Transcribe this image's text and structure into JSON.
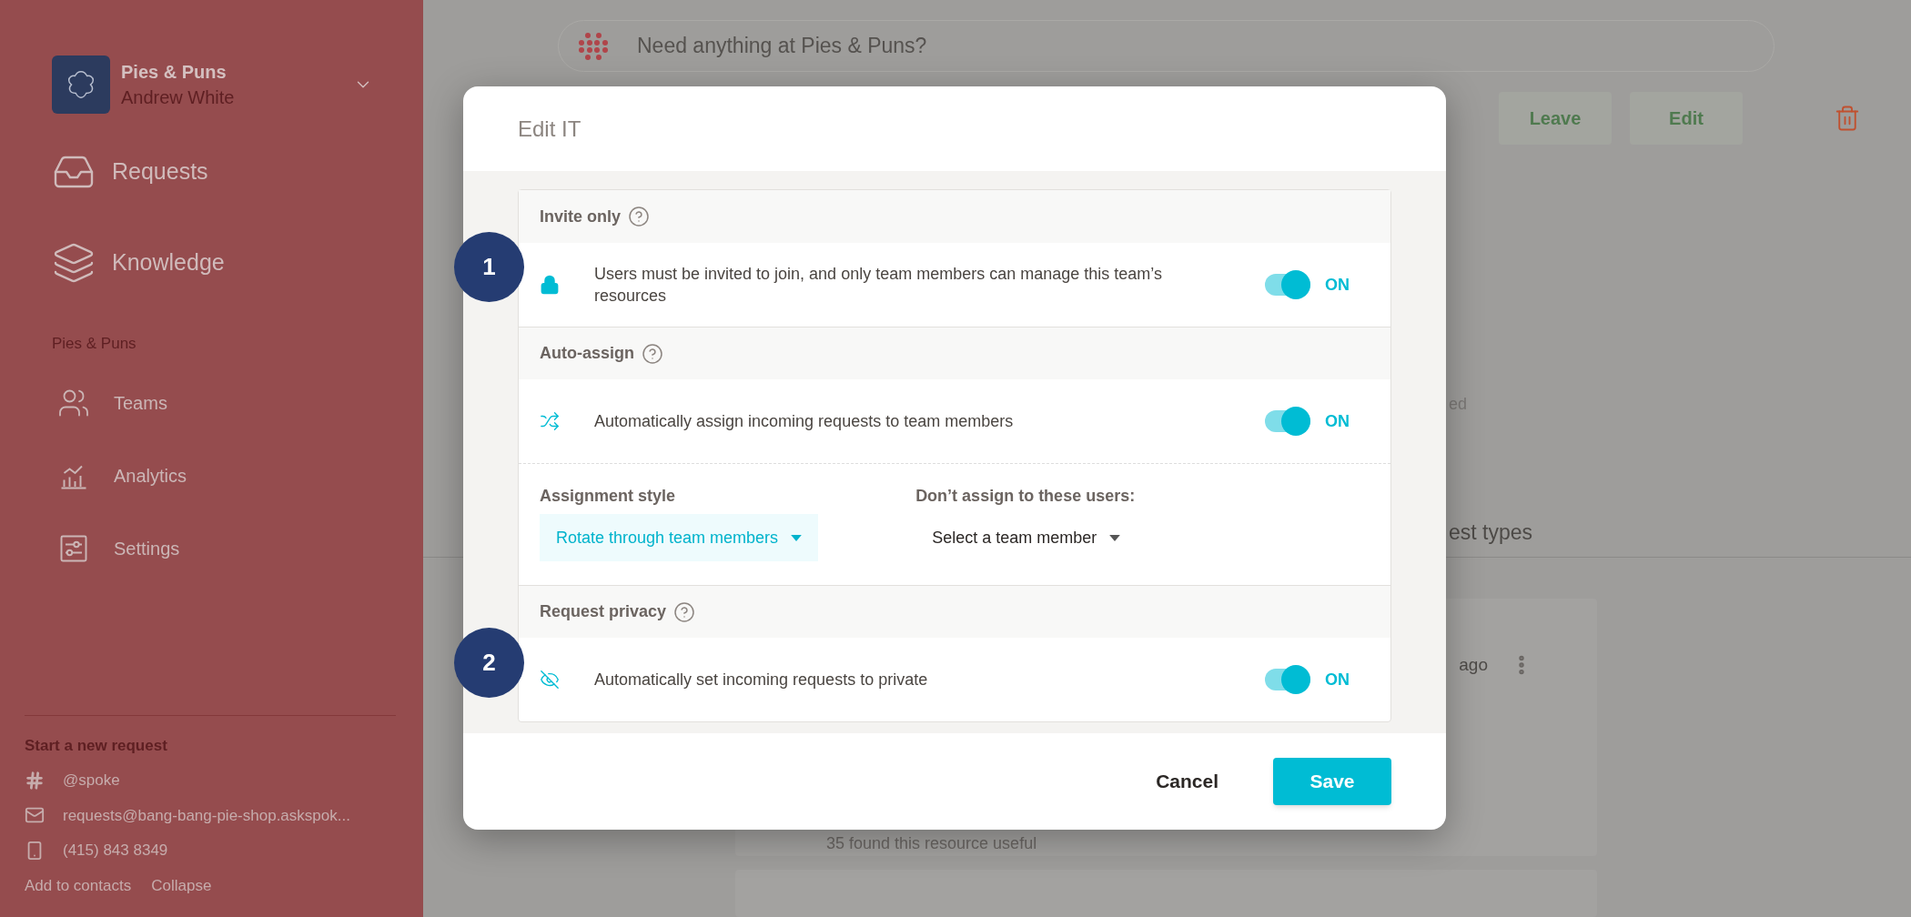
{
  "sidebar": {
    "workspace": {
      "name": "Pies & Puns",
      "user": "Andrew White"
    },
    "nav": [
      {
        "label": "Requests",
        "kind": "inbox"
      },
      {
        "label": "Knowledge",
        "kind": "layers"
      }
    ],
    "section_title": "Pies & Puns",
    "section_items": [
      {
        "label": "Teams",
        "kind": "users"
      },
      {
        "label": "Analytics",
        "kind": "analytics"
      },
      {
        "label": "Settings",
        "kind": "settings"
      }
    ],
    "contact": {
      "title": "Start a new request",
      "items": [
        {
          "kind": "slack",
          "text": "@spoke"
        },
        {
          "kind": "email",
          "text": "requests@bang-bang-pie-shop.askspok..."
        },
        {
          "kind": "phone",
          "text": "(415) 843 8349"
        }
      ],
      "links": [
        "Add to contacts",
        "Collapse"
      ]
    }
  },
  "search": {
    "placeholder": "Need anything at Pies & Puns?"
  },
  "header_actions": [
    "Leave",
    "Edit"
  ],
  "background": {
    "fragment": "ed",
    "tab_fragment": "est types",
    "card_time": "ago",
    "card_text": "35 found this resource useful"
  },
  "modal": {
    "title": "Edit IT",
    "sections": [
      {
        "title": "Invite only",
        "marker": "1",
        "rows": [
          {
            "kind": "toggle",
            "text": "Users must be invited to join, and only team members can manage this team’s resources",
            "on": true,
            "state_label": "ON"
          }
        ]
      },
      {
        "title": "Auto-assign",
        "rows": [
          {
            "kind": "toggle",
            "text": "Automatically assign incoming requests to team members",
            "on": true,
            "state_label": "ON"
          },
          {
            "kind": "selects",
            "fields": [
              {
                "label": "Assignment style",
                "value": "Rotate through team members",
                "highlighted": true
              },
              {
                "label": "Don’t assign to these users:",
                "value": "Select a team member",
                "highlighted": false
              }
            ]
          }
        ]
      },
      {
        "title": "Request privacy",
        "marker": "2",
        "rows": [
          {
            "kind": "toggle",
            "text": "Automatically set incoming requests to private",
            "on": true,
            "state_label": "ON"
          }
        ]
      }
    ],
    "cancel": "Cancel",
    "save": "Save"
  }
}
